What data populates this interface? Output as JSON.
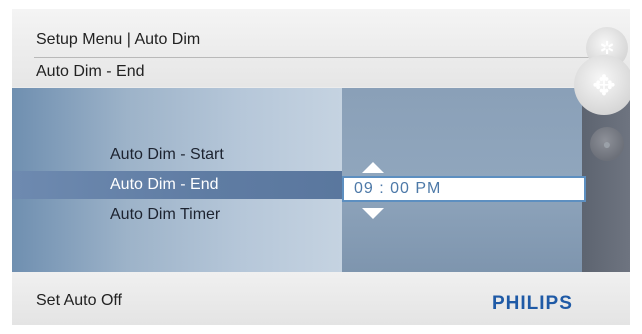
{
  "header": {
    "title": "Setup Menu | Auto Dim",
    "subtitle": "Auto Dim - End"
  },
  "menu": {
    "items": [
      {
        "label": "Auto Dim - Start"
      },
      {
        "label": "Auto Dim - End"
      },
      {
        "label": "Auto Dim Timer"
      }
    ],
    "selected_index": 1
  },
  "time_picker": {
    "value": "09 : 00  PM"
  },
  "footer": {
    "hint": "Set Auto Off",
    "brand": "PHILIPS"
  },
  "icons": {
    "top": "settings-dial-icon",
    "middle": "navigation-dial-icon",
    "bottom": "back-dial-icon"
  },
  "colors": {
    "brand": "#1f5aa6",
    "selection": "#5f7ca3",
    "field_border": "#5d8fc0"
  }
}
